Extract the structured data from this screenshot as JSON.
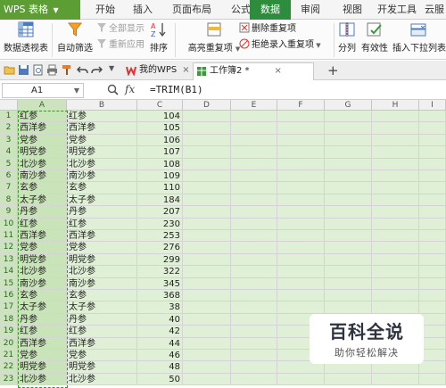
{
  "menubar": {
    "app_label": "WPS 表格",
    "tabs": [
      {
        "label": "开始",
        "active": false
      },
      {
        "label": "插入",
        "active": false
      },
      {
        "label": "页面布局",
        "active": false
      },
      {
        "label": "公式",
        "active": false
      },
      {
        "label": "数据",
        "active": true
      },
      {
        "label": "审阅",
        "active": false
      },
      {
        "label": "视图",
        "active": false
      },
      {
        "label": "开发工具",
        "active": false
      },
      {
        "label": "云服",
        "active": false
      }
    ]
  },
  "ribbon": {
    "pivot_table": "数据透视表",
    "auto_filter": "自动筛选",
    "show_all": "全部显示",
    "reapply": "重新应用",
    "sort": "排序",
    "highlight_duplicates": "高亮重复项",
    "remove_duplicates": "删除重复项",
    "reject_duplicates": "拒绝录入重复项",
    "split_columns": "分列",
    "validity": "有效性",
    "insert_dropdown": "插入下拉列表"
  },
  "doc_tabs": {
    "wps_tab": "我的WPS",
    "workbook_tab": "工作簿2 *",
    "new_tab_symbol": "+"
  },
  "formula_bar": {
    "cell_ref": "A1",
    "fx": "fx",
    "formula": "=TRIM(B1)"
  },
  "grid": {
    "columns": [
      "A",
      "B",
      "C",
      "D",
      "E",
      "F",
      "G",
      "H",
      "I"
    ],
    "selected_column": "A",
    "rows": [
      {
        "num": "1",
        "a": "红参",
        "b": "红参",
        "c": "104"
      },
      {
        "num": "2",
        "a": "西洋参",
        "b": "西洋参",
        "c": "105"
      },
      {
        "num": "3",
        "a": "党参",
        "b": "党参",
        "c": "106"
      },
      {
        "num": "4",
        "a": "明党参",
        "b": "明党参",
        "c": "107"
      },
      {
        "num": "5",
        "a": "北沙参",
        "b": "北沙参",
        "c": "108"
      },
      {
        "num": "6",
        "a": "南沙参",
        "b": "南沙参",
        "c": "109"
      },
      {
        "num": "7",
        "a": "玄参",
        "b": "玄参",
        "c": "110"
      },
      {
        "num": "8",
        "a": "太子参",
        "b": "太子参",
        "c": "184"
      },
      {
        "num": "9",
        "a": "丹参",
        "b": "丹参",
        "c": "207"
      },
      {
        "num": "10",
        "a": "红参",
        "b": "红参",
        "c": "230"
      },
      {
        "num": "11",
        "a": "西洋参",
        "b": "西洋参",
        "c": "253"
      },
      {
        "num": "12",
        "a": "党参",
        "b": "党参",
        "c": "276"
      },
      {
        "num": "13",
        "a": "明党参",
        "b": "明党参",
        "c": "299"
      },
      {
        "num": "14",
        "a": "北沙参",
        "b": "北沙参",
        "c": "322"
      },
      {
        "num": "15",
        "a": "南沙参",
        "b": "南沙参",
        "c": "345"
      },
      {
        "num": "16",
        "a": "玄参",
        "b": "玄参",
        "c": "368"
      },
      {
        "num": "17",
        "a": "太子参",
        "b": "太子参",
        "c": "38"
      },
      {
        "num": "18",
        "a": "丹参",
        "b": "丹参",
        "c": "40"
      },
      {
        "num": "19",
        "a": "红参",
        "b": "红参",
        "c": "42"
      },
      {
        "num": "20",
        "a": "西洋参",
        "b": "西洋参",
        "c": "44"
      },
      {
        "num": "21",
        "a": "党参",
        "b": "党参",
        "c": "46"
      },
      {
        "num": "22",
        "a": "明党参",
        "b": "明党参",
        "c": "48"
      },
      {
        "num": "23",
        "a": "北沙参",
        "b": "北沙参",
        "c": "50"
      }
    ]
  },
  "watermark": {
    "title": "百科全说",
    "subtitle": "助你轻松解决"
  },
  "colors": {
    "app_green": "#5c9e33",
    "active_tab_green": "#2e8d3c",
    "selected_column_fill": "#c9e4b8",
    "sheet_fill": "#e0f0d6"
  }
}
